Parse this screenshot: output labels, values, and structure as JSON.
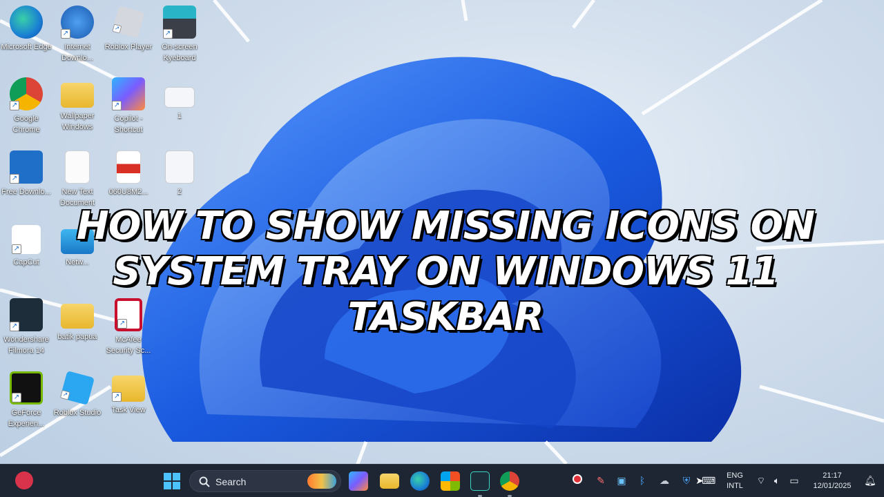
{
  "desktop": {
    "icons": [
      {
        "label": "Microsoft Edge",
        "icon": "edge-icon"
      },
      {
        "label": "Internet Downlo...",
        "icon": "download-manager-icon"
      },
      {
        "label": "Roblox Player",
        "icon": "roblox-icon"
      },
      {
        "label": "On-screen Kyeboard",
        "icon": "keyboard-icon"
      },
      {
        "label": "Google Chrome",
        "icon": "chrome-icon"
      },
      {
        "label": "Wallpaper Windows",
        "icon": "folder-icon"
      },
      {
        "label": "Copilot - Shortcut",
        "icon": "copilot-icon"
      },
      {
        "label": "1",
        "icon": "image-file-icon"
      },
      {
        "label": "Free Downlo...",
        "icon": "download-app-icon"
      },
      {
        "label": "New Text Document",
        "icon": "text-document-icon"
      },
      {
        "label": "060U8M2...",
        "icon": "pdf-icon"
      },
      {
        "label": "2",
        "icon": "image-file-icon"
      },
      {
        "label": "CapCut",
        "icon": "capcut-icon"
      },
      {
        "label": "Netw...",
        "icon": "network-icon"
      },
      {
        "label": "Wondershare Filmora 14",
        "icon": "filmora-icon"
      },
      {
        "label": "batik papua",
        "icon": "folder-icon"
      },
      {
        "label": "McAfee Security Sc...",
        "icon": "mcafee-icon"
      },
      {
        "label": "GeForce Experien...",
        "icon": "nvidia-icon"
      },
      {
        "label": "Roblox Studio",
        "icon": "roblox-studio-icon"
      },
      {
        "label": "Task View",
        "icon": "folder-icon"
      }
    ]
  },
  "headline": {
    "line1": "HOW TO SHOW MISSING ICONS ON",
    "line2": "SYSTEM TRAY ON WINDOWS 11 TASKBAR"
  },
  "taskbar": {
    "search_label": "Search",
    "pinned": [
      "copilot-icon",
      "file-explorer-icon",
      "edge-icon",
      "microsoft-store-icon",
      "filmora-icon",
      "chrome-icon"
    ],
    "tray_icons": [
      "recording-icon",
      "pen-icon",
      "capture-icon",
      "bluetooth-icon",
      "onedrive-icon",
      "security-warning-icon",
      "keyboard-icon",
      "wifi-icon",
      "volume-icon",
      "battery-icon",
      "notification-icon"
    ],
    "language_line1": "ENG",
    "language_line2": "INTL",
    "time": "21:17",
    "date": "12/01/2025"
  },
  "colors": {
    "taskbar_bg": "#1f2633",
    "wallpaper_bloom": "#1a5be0",
    "headline_fill": "#ffffff",
    "headline_stroke": "#000000"
  }
}
